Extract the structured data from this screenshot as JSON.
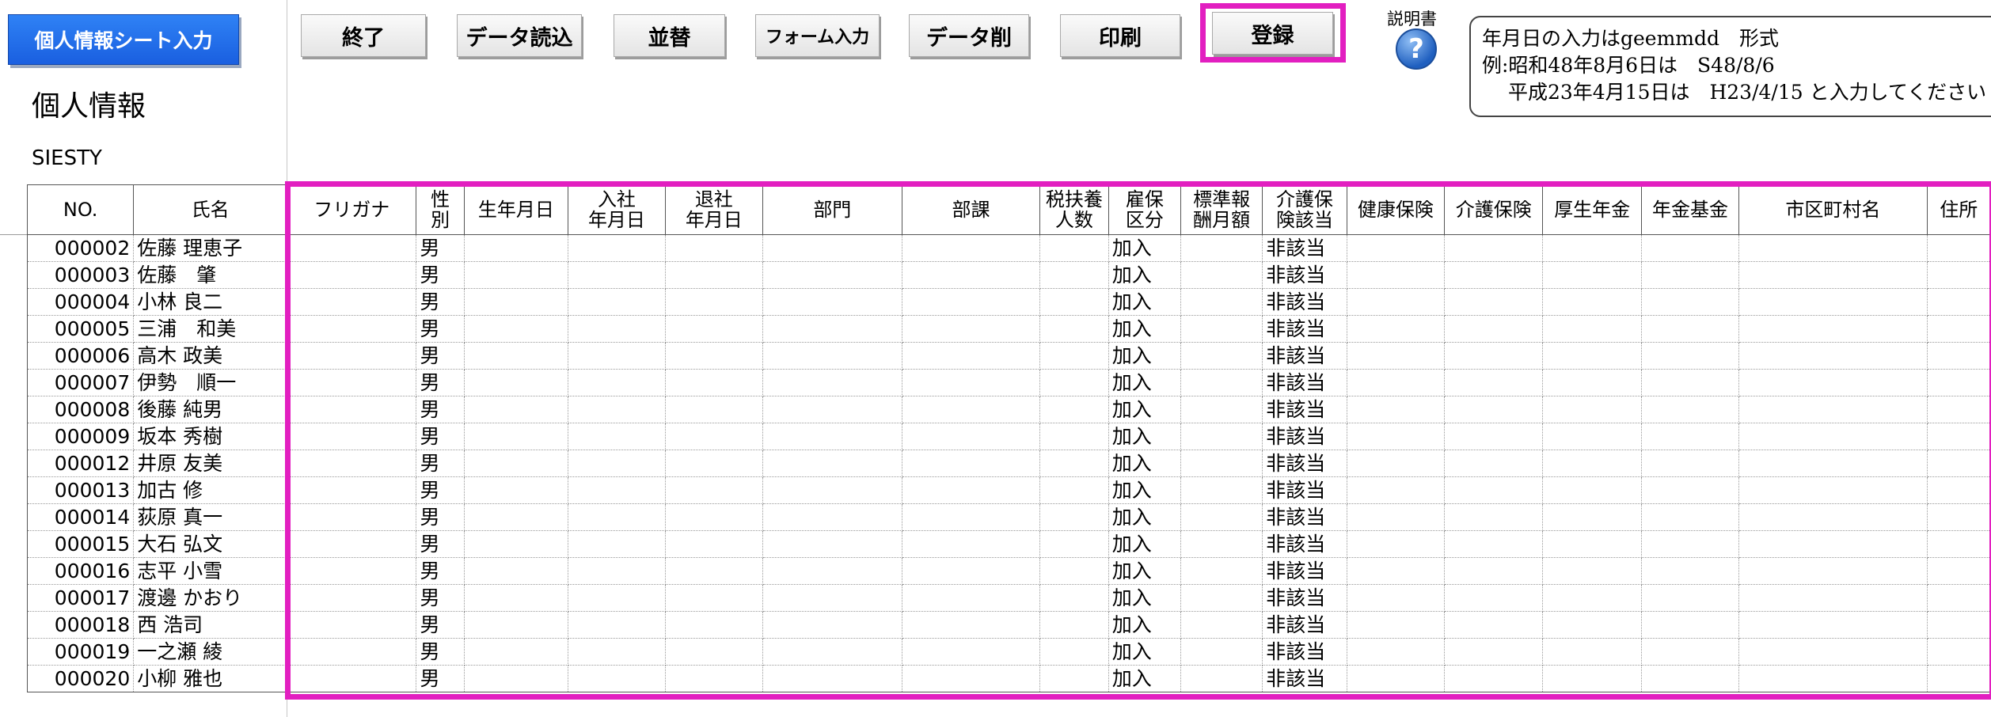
{
  "app": {
    "title": "個人情報シート入力",
    "page_title": "個人情報",
    "company": "SIESTY"
  },
  "toolbar": {
    "buttons": [
      {
        "label": "終了"
      },
      {
        "label": "データ読込"
      },
      {
        "label": "並替"
      },
      {
        "label": "フォーム入力"
      },
      {
        "label": "データ削"
      },
      {
        "label": "印刷"
      },
      {
        "label": "登録"
      }
    ],
    "help_label": "説明書",
    "help_icon": "?"
  },
  "note": {
    "line1": "年月日の入力はgeemmdd　形式",
    "line2": "例:昭和48年8月6日は　S48/8/6",
    "line3": "　 平成23年4月15日は　H23/4/15 と入力してください"
  },
  "highlight_color": "#e21fc0",
  "table": {
    "headers": [
      "NO.",
      "氏名",
      "フリガナ",
      "性\n別",
      "生年月日",
      "入社\n年月日",
      "退社\n年月日",
      "部門",
      "部課",
      "税扶養\n人数",
      "雇保\n区分",
      "標準報\n酬月額",
      "介護保\n険該当",
      "健康保険",
      "介護保険",
      "厚生年金",
      "年金基金",
      "市区町村名",
      "住所"
    ],
    "rows": [
      {
        "no": "000002",
        "name": "佐藤 理恵子",
        "sex": "男",
        "ins": "加入",
        "care": "非該当"
      },
      {
        "no": "000003",
        "name": "佐藤　肇",
        "sex": "男",
        "ins": "加入",
        "care": "非該当"
      },
      {
        "no": "000004",
        "name": "小林 良二",
        "sex": "男",
        "ins": "加入",
        "care": "非該当"
      },
      {
        "no": "000005",
        "name": "三浦　和美",
        "sex": "男",
        "ins": "加入",
        "care": "非該当"
      },
      {
        "no": "000006",
        "name": "高木 政美",
        "sex": "男",
        "ins": "加入",
        "care": "非該当"
      },
      {
        "no": "000007",
        "name": "伊勢　順一",
        "sex": "男",
        "ins": "加入",
        "care": "非該当"
      },
      {
        "no": "000008",
        "name": "後藤 純男",
        "sex": "男",
        "ins": "加入",
        "care": "非該当"
      },
      {
        "no": "000009",
        "name": "坂本 秀樹",
        "sex": "男",
        "ins": "加入",
        "care": "非該当"
      },
      {
        "no": "000012",
        "name": "井原 友美",
        "sex": "男",
        "ins": "加入",
        "care": "非該当"
      },
      {
        "no": "000013",
        "name": "加古 修",
        "sex": "男",
        "ins": "加入",
        "care": "非該当"
      },
      {
        "no": "000014",
        "name": "荻原 真一",
        "sex": "男",
        "ins": "加入",
        "care": "非該当"
      },
      {
        "no": "000015",
        "name": "大石 弘文",
        "sex": "男",
        "ins": "加入",
        "care": "非該当"
      },
      {
        "no": "000016",
        "name": "志平 小雪",
        "sex": "男",
        "ins": "加入",
        "care": "非該当"
      },
      {
        "no": "000017",
        "name": "渡邊 かおり",
        "sex": "男",
        "ins": "加入",
        "care": "非該当"
      },
      {
        "no": "000018",
        "name": "西 浩司",
        "sex": "男",
        "ins": "加入",
        "care": "非該当"
      },
      {
        "no": "000019",
        "name": "一之瀬 綾",
        "sex": "男",
        "ins": "加入",
        "care": "非該当"
      },
      {
        "no": "000020",
        "name": "小柳 雅也",
        "sex": "男",
        "ins": "加入",
        "care": "非該当"
      }
    ]
  }
}
